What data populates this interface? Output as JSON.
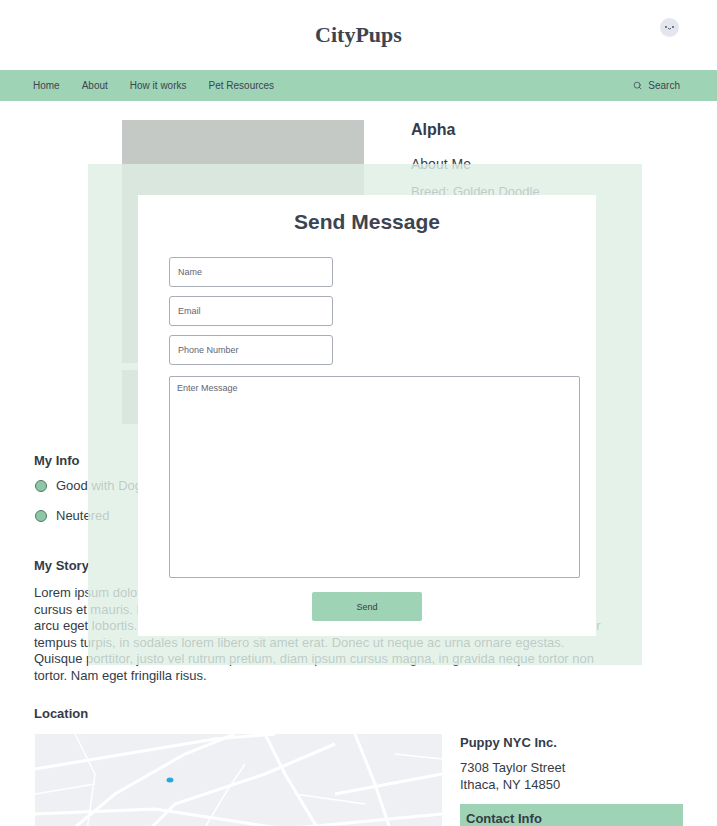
{
  "header": {
    "logo": "CityPups"
  },
  "nav": {
    "items": [
      "Home",
      "About",
      "How it works",
      "Pet Resources"
    ],
    "search": "Search"
  },
  "profile": {
    "name": "Alpha",
    "about_heading": "About Me",
    "about_lines": [
      "Breed: Golden Doodle"
    ]
  },
  "info": {
    "heading": "My Info",
    "items": [
      {
        "label": "Good with Dogs",
        "checked": true
      },
      {
        "label": "Neutered",
        "checked": true
      }
    ]
  },
  "story": {
    "heading": "My Story",
    "text": "Lorem ipsum dolor sit amet, consectetur adipiscing elit. Integer nec odio. Praesent libero. Sed cursus et mauris. Nullam nec massa sed augue semper porta. Mauris massa. Vestibulum lacinia arcu eget lobortis. Proin a velit nec tellus sodales sagittis, class aptent taciti sociosqu fringilla tortor tempus turpis, in sodales lorem libero sit amet erat. Donec ut neque ac urna ornare egestas. Quisque porttitor, justo vel rutrum pretium, diam ipsum cursus magna, in gravida neque tortor non tortor. Nam eget fringilla risus."
  },
  "location": {
    "heading": "Location",
    "name": "Puppy NYC Inc.",
    "address": [
      "7308 Taylor Street",
      "Ithaca, NY 14850"
    ],
    "contact_heading": "Contact Info"
  },
  "modal": {
    "title": "Send Message",
    "fields": [
      {
        "placeholder": "Name"
      },
      {
        "placeholder": "Email"
      },
      {
        "placeholder": "Phone Number"
      }
    ],
    "message_placeholder": "Enter Message",
    "button": "Send"
  }
}
